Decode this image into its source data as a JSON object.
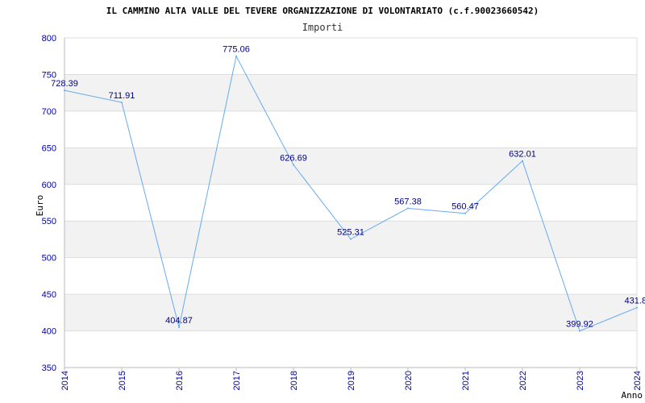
{
  "chart_data": {
    "type": "line",
    "title": "IL CAMMINO ALTA VALLE DEL TEVERE ORGANIZZAZIONE DI VOLONTARIATO (c.f.90023660542)",
    "subtitle": "Importi",
    "xlabel": "Anno",
    "ylabel": "Euro",
    "ylim": [
      350,
      800
    ],
    "yticks": [
      350,
      400,
      450,
      500,
      550,
      600,
      650,
      700,
      750,
      800
    ],
    "grid": true,
    "x": [
      "2014",
      "2015",
      "2016",
      "2017",
      "2018",
      "2019",
      "2020",
      "2021",
      "2022",
      "2023",
      "2024"
    ],
    "series": [
      {
        "values": [
          728.39,
          711.91,
          404.87,
          775.06,
          626.69,
          525.31,
          567.38,
          560.47,
          632.01,
          399.92,
          431.8
        ],
        "labels": [
          "728.39",
          "711.91",
          "404.87",
          "775.06",
          "626.69",
          "525.31",
          "567.38",
          "560.47",
          "632.01",
          "399.92",
          "431.8"
        ]
      }
    ],
    "colors": {
      "line": "#66aaee",
      "band": "#f2f2f2",
      "grid": "#dddddd",
      "axis": "#bbbbbb",
      "tick_text": "#0000aa",
      "label_text": "#000080"
    }
  }
}
